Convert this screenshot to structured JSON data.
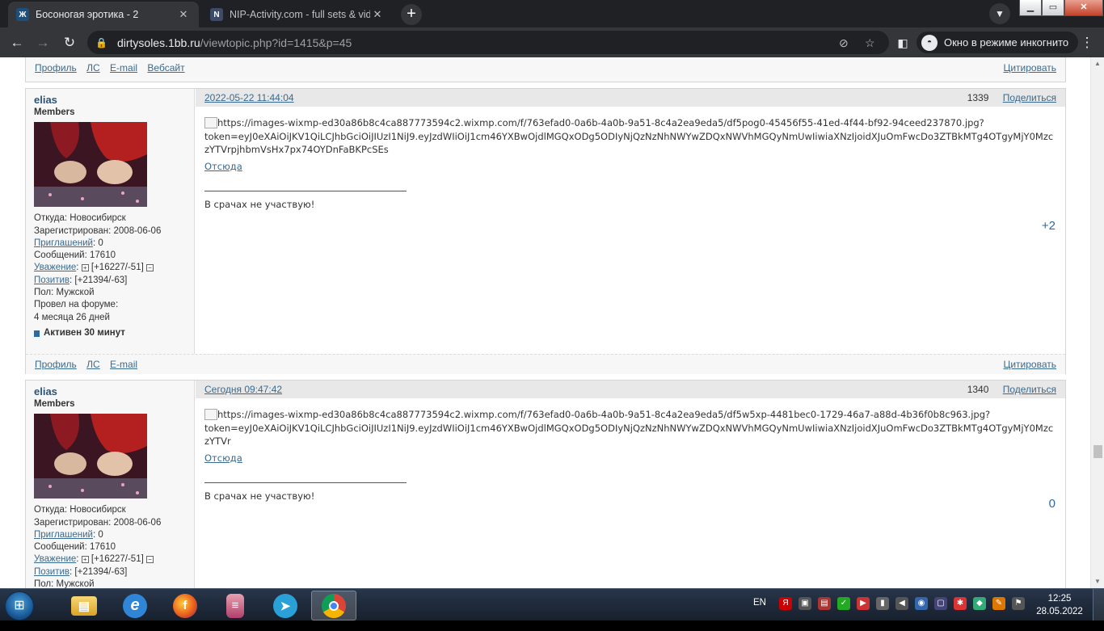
{
  "browser": {
    "tabs": [
      {
        "title": "Босоногая эротика - 2",
        "active": true,
        "favicon": "forum-favicon"
      },
      {
        "title": "NIP-Activity.com - full sets & vide",
        "active": false,
        "favicon": "nip-favicon"
      }
    ],
    "new_tab": "+",
    "tab_search": "⌄",
    "window_controls": {
      "minimize": "▁",
      "maximize": "▭",
      "close": "✕"
    },
    "nav": {
      "back": "←",
      "forward": "→",
      "reload": "↻"
    },
    "url_host": "dirtysoles.1bb.ru",
    "url_path": "/viewtopic.php?id=1415&p=45",
    "omnibox_icons": [
      "eye-off-icon",
      "star-icon"
    ],
    "incognito_label": "Окно в режиме инкогнито",
    "menu": "⋮",
    "sidepanel": "◧"
  },
  "page": {
    "top_links": {
      "left": [
        "Профиль",
        "ЛС",
        "E-mail",
        "Вебсайт"
      ],
      "right": "Цитировать"
    },
    "posts": [
      {
        "author": {
          "name": "elias",
          "group": "Members",
          "from_label": "Откуда:",
          "from": "Новосибирск",
          "registered_label": "Зарегистрирован:",
          "registered": "2008-06-06",
          "invites_label": "Приглашений",
          "invites": "0",
          "messages_label": "Сообщений:",
          "messages": "17610",
          "respect_label": "Уважение",
          "respect": "[+16227/-51]",
          "positive_label": "Позитив",
          "positive": "[+21394/-63]",
          "gender_label": "Пол:",
          "gender": "Мужской",
          "time_on_forum_label": "Провел на форуме:",
          "time_on_forum": "4 месяца 26 дней",
          "active": "Активен 30 минут"
        },
        "date": "2022-05-22 11:44:04",
        "number": "1339",
        "share": "Поделиться",
        "image_url_line1": "https://images-wixmp-ed30a86b8c4ca887773594c2.wixmp.com/f/763efad0-0a6b-4a0b-9a51-8c4a2ea9eda5/df5pog0-45456f55-41ed-4f44-bf92-94ceed237870.jpg?",
        "image_url_line2": "token=eyJ0eXAiOiJKV1QiLCJhbGciOiJIUzI1NiJ9.eyJzdWIiOiJ1cm46YXBwOjdlMGQxODg5ODIyNjQzNzNhNWYwZDQxNWVhMGQyNmUwIiwiaXNzIjoidXJuOmFwcDo3ZTBkMTg4OTgyMjY0MzczYTVrpjhbmVsHx7px74OYDnFaBKPcSEs",
        "source_link": "Отсюда",
        "signature": "В срачах не участвую!",
        "rating": "+2",
        "links": {
          "left": [
            "Профиль",
            "ЛС",
            "E-mail"
          ],
          "right": "Цитировать"
        }
      },
      {
        "author": {
          "name": "elias",
          "group": "Members",
          "from_label": "Откуда:",
          "from": "Новосибирск",
          "registered_label": "Зарегистрирован:",
          "registered": "2008-06-06",
          "invites_label": "Приглашений",
          "invites": "0",
          "messages_label": "Сообщений:",
          "messages": "17610",
          "respect_label": "Уважение",
          "respect": "[+16227/-51]",
          "positive_label": "Позитив",
          "positive": "[+21394/-63]",
          "gender_label": "Пол:",
          "gender": "Мужской"
        },
        "date": "Сегодня 09:47:42",
        "number": "1340",
        "share": "Поделиться",
        "image_url_line1": "https://images-wixmp-ed30a86b8c4ca887773594c2.wixmp.com/f/763efad0-0a6b-4a0b-9a51-8c4a2ea9eda5/df5w5xp-4481bec0-1729-46a7-a88d-4b36f0b8c963.jpg?",
        "image_url_line2": "token=eyJ0eXAiOiJKV1QiLCJhbGciOiJIUzI1NiJ9.eyJzdWIiOiJ1cm46YXBwOjdlMGQxODg5ODIyNjQzNzNhNWYwZDQxNWVhMGQyNmUwIiwiaXNzIjoidXJuOmFwcDo3ZTBkMTg4OTgyMjY0MzczYTVr",
        "source_link": "Отсюда",
        "signature": "В срачах не участвую!",
        "rating": "0"
      }
    ]
  },
  "taskbar": {
    "apps": [
      "explorer-folder-icon",
      "internet-explorer-icon",
      "firefox-icon",
      "database-app-icon",
      "telegram-icon",
      "chrome-icon"
    ],
    "language": "EN",
    "time": "12:25",
    "date": "28.05.2022"
  },
  "colors": {
    "link": "#3a6a8e",
    "rating": "#2c6aa4",
    "post_header": "#e8e8e8"
  }
}
